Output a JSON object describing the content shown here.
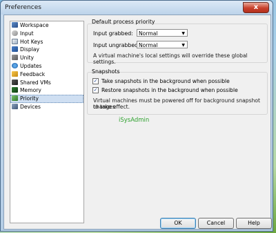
{
  "window": {
    "title": "Preferences",
    "close_glyph": "x"
  },
  "sidebar": {
    "items": [
      {
        "label": "Workspace",
        "icon": "workspace-icon"
      },
      {
        "label": "Input",
        "icon": "input-icon"
      },
      {
        "label": "Hot Keys",
        "icon": "hot-keys-icon"
      },
      {
        "label": "Display",
        "icon": "display-icon"
      },
      {
        "label": "Unity",
        "icon": "unity-icon"
      },
      {
        "label": "Updates",
        "icon": "updates-icon"
      },
      {
        "label": "Feedback",
        "icon": "feedback-icon"
      },
      {
        "label": "Shared VMs",
        "icon": "shared-vms-icon"
      },
      {
        "label": "Memory",
        "icon": "memory-icon"
      },
      {
        "label": "Priority",
        "icon": "priority-icon",
        "selected": true
      },
      {
        "label": "Devices",
        "icon": "devices-icon"
      }
    ]
  },
  "priority": {
    "section_title": "Default process priority",
    "grabbed_label": "Input grabbed:",
    "grabbed_value": "Normal",
    "ungrabbed_label": "Input ungrabbed:",
    "ungrabbed_value": "Normal",
    "note": "A virtual machine's local settings will override these global settings."
  },
  "snapshots": {
    "section_title": "Snapshots",
    "take_label": "Take snapshots in the background when possible",
    "take_checked": true,
    "restore_label": "Restore snapshots in the background when possible",
    "restore_checked": true,
    "note_line1": "Virtual machines must be powered off for background snapshot changes",
    "note_line2": "to take effect."
  },
  "watermark": "iSysAdmin",
  "buttons": {
    "ok": "OK",
    "cancel": "Cancel",
    "help": "Help"
  },
  "colors": {
    "watermark": "#2ea12e",
    "selection": "#cfdff2"
  }
}
